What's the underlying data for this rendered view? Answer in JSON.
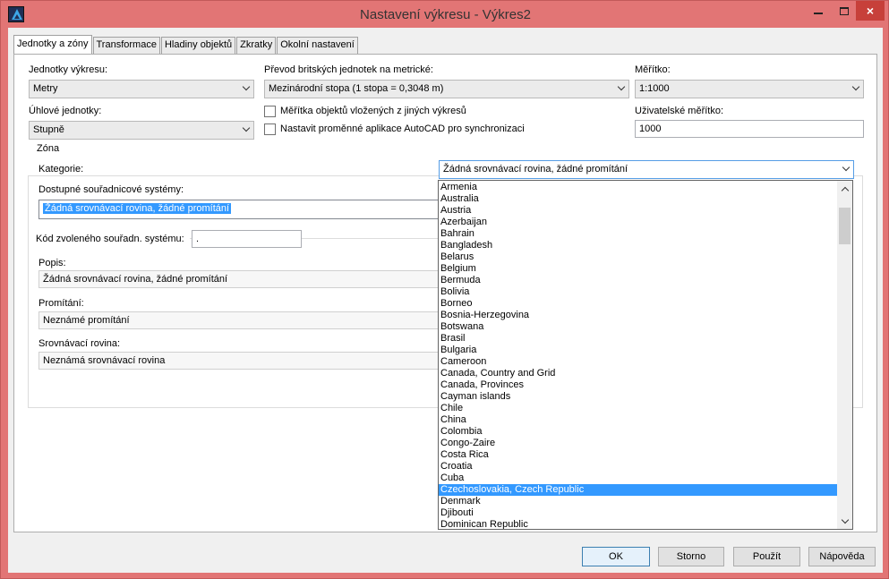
{
  "window": {
    "title": "Nastavení výkresu - Výkres2",
    "close_label": "×"
  },
  "tabs": [
    {
      "label": "Jednotky a zóny",
      "active": true
    },
    {
      "label": "Transformace"
    },
    {
      "label": "Hladiny objektů"
    },
    {
      "label": "Zkratky"
    },
    {
      "label": "Okolní nastavení"
    }
  ],
  "units": {
    "drawing_units_label": "Jednotky výkresu:",
    "drawing_units_value": "Metry",
    "angular_units_label": "Úhlové jednotky:",
    "angular_units_value": "Stupně",
    "conversion_label": "Převod britských jednotek na metrické:",
    "conversion_value": "Mezinárodní stopa (1 stopa = 0,3048 m)",
    "scale_objects_label": "Měřítka objektů vložených z jiných výkresů",
    "sync_vars_label": "Nastavit proměnné aplikace AutoCAD pro synchronizaci",
    "scale_label": "Měřítko:",
    "scale_value": "1:1000",
    "custom_scale_label": "Uživatelské měřítko:",
    "custom_scale_value": "1000"
  },
  "zone": {
    "group_title": "Zóna",
    "category_label": "Kategorie:",
    "category_value": "Žádná srovnávací rovina, žádné promítání",
    "available_label": "Dostupné souřadnicové systémy:",
    "available_selected": "Žádná srovnávací rovina, žádné promítání",
    "code_label": "Kód zvoleného souřadn. systému:",
    "code_value": ".",
    "desc_label": "Popis:",
    "desc_value": "Žádná srovnávací rovina, žádné promítání",
    "projection_label": "Promítání:",
    "projection_value": "Neznámé promítání",
    "datum_label": "Srovnávací rovina:",
    "datum_value": "Neznámá srovnávací rovina"
  },
  "dropdown": {
    "highlighted": "Czechoslovakia, Czech Republic",
    "items": [
      "Armenia",
      "Australia",
      "Austria",
      "Azerbaijan",
      "Bahrain",
      "Bangladesh",
      "Belarus",
      "Belgium",
      "Bermuda",
      "Bolivia",
      "Borneo",
      "Bosnia-Herzegovina",
      "Botswana",
      "Brasil",
      "Bulgaria",
      "Cameroon",
      "Canada, Country and Grid",
      "Canada, Provinces",
      "Cayman islands",
      "Chile",
      "China",
      "Colombia",
      "Congo-Zaire",
      "Costa Rica",
      "Croatia",
      "Cuba",
      "Czechoslovakia, Czech Republic",
      "Denmark",
      "Djibouti",
      "Dominican Republic"
    ]
  },
  "buttons": {
    "ok": "OK",
    "cancel": "Storno",
    "apply": "Použít",
    "help": "Nápověda"
  }
}
